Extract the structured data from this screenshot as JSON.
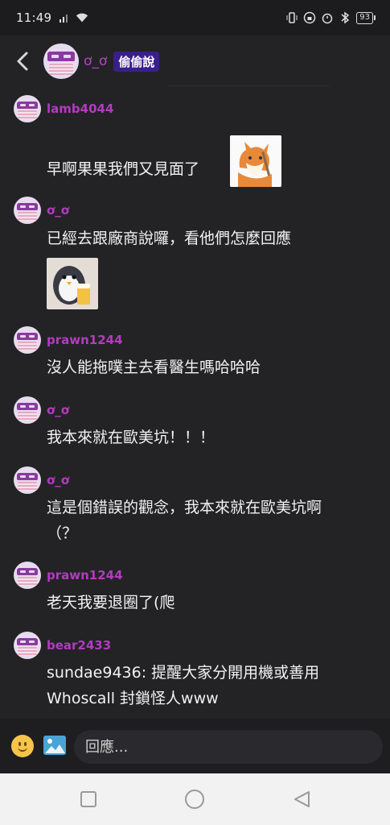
{
  "status_bar": {
    "time": "11:49",
    "battery": "93"
  },
  "header": {
    "name": "ơ_ơ",
    "badge": "偷偷說"
  },
  "messages": [
    {
      "username": "lamb4044",
      "text": "早啊果果我們又見面了",
      "sticker": "fox-sticker"
    },
    {
      "username": "ơ_ơ",
      "text": "已經去跟廠商說囉，看他們怎麼回應",
      "sticker": "penguin-beer-sticker"
    },
    {
      "username": "prawn1244",
      "text": "沒人能拖噗主去看醫生嗎哈哈哈"
    },
    {
      "username": "ơ_ơ",
      "text": "我本來就在歐美坑！！！"
    },
    {
      "username": "ơ_ơ",
      "text_line1": "這是個錯誤的觀念，我本來就在歐美坑啊",
      "text_line2": "（？"
    },
    {
      "username": "prawn1244",
      "text": "老天我要退圈了(爬"
    },
    {
      "username": "bear2433",
      "text_line1": "sundae9436: 提醒大家分開用機或善用",
      "text_line2": "Whoscall 封鎖怪人www"
    }
  ],
  "input": {
    "placeholder": "回應..."
  },
  "colors": {
    "background": "#232326",
    "username": "#b33bbf",
    "badge": "#3a1f8c"
  }
}
